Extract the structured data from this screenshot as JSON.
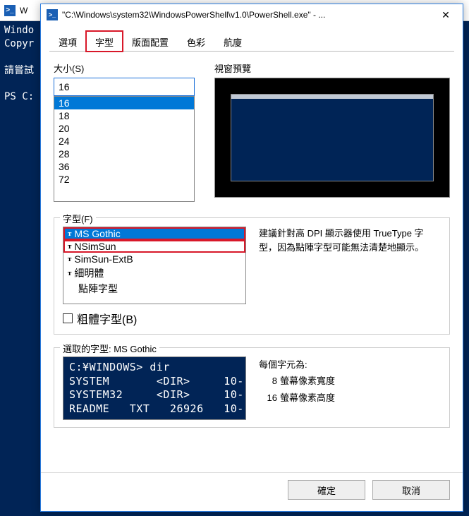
{
  "background": {
    "title": "W",
    "console_lines": "Windo\nCopyr\n\n請嘗試\n\nPS C:",
    "trail": "」。"
  },
  "dialog": {
    "title": "\"C:\\Windows\\system32\\WindowsPowerShell\\v1.0\\PowerShell.exe\" - ...",
    "tabs": [
      "選項",
      "字型",
      "版面配置",
      "色彩",
      "航廈"
    ],
    "active_tab": 1,
    "size": {
      "label": "大小(S)",
      "value": "16",
      "options": [
        "16",
        "18",
        "20",
        "24",
        "28",
        "36",
        "72"
      ],
      "selected_index": 0
    },
    "preview": {
      "label": "視窗預覽"
    },
    "font": {
      "legend": "字型(F)",
      "items": [
        {
          "tt": true,
          "name": "MS Gothic"
        },
        {
          "tt": true,
          "name": "NSimSun"
        },
        {
          "tt": true,
          "name": "SimSun-ExtB"
        },
        {
          "tt": true,
          "name": "細明體"
        },
        {
          "tt": false,
          "name": "點陣字型"
        }
      ],
      "selected_index": 0,
      "hint": "建議針對高 DPI 顯示器使用 TrueType 字型，因為點陣字型可能無法清楚地顯示。",
      "bold_label": "粗體字型(B)",
      "bold_checked": false
    },
    "selected": {
      "legend_prefix": "選取的字型: ",
      "legend_font": "MS Gothic",
      "sample": "C:¥WINDOWS> dir\nSYSTEM       <DIR>     10-\nSYSTEM32     <DIR>     10-\nREADME   TXT   26926   10-",
      "dim_label": "每個字元為:",
      "width_num": "8",
      "width_label": "螢幕像素寬度",
      "height_num": "16",
      "height_label": "螢幕像素高度"
    },
    "buttons": {
      "ok": "確定",
      "cancel": "取消"
    }
  }
}
